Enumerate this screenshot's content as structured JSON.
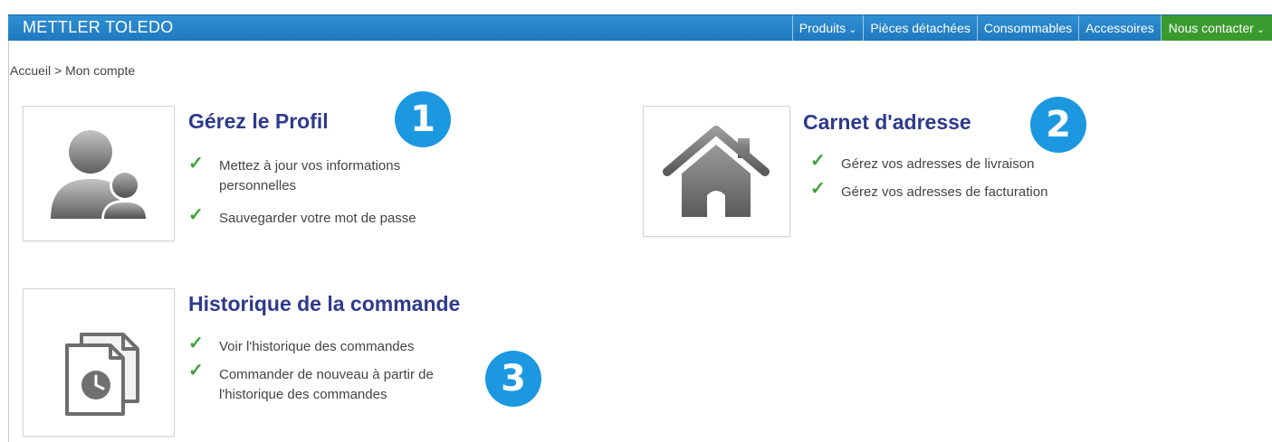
{
  "header": {
    "brand": "METTLER TOLEDO",
    "nav": [
      {
        "label": "Produits",
        "dropdown": true
      },
      {
        "label": "Pièces détachées"
      },
      {
        "label": "Consommables"
      },
      {
        "label": "Accessoires"
      },
      {
        "label": "Nous contacter",
        "dropdown": true
      }
    ]
  },
  "breadcrumb": {
    "home": "Accueil",
    "separator": ">",
    "current": "Mon compte"
  },
  "sections": {
    "profile": {
      "title": "Gérez le Profil",
      "badge": "1",
      "items": [
        "Mettez à jour vos informations personnelles",
        "Sauvegarder votre mot de passe"
      ],
      "icon": "user-profile-icon"
    },
    "addresses": {
      "title": "Carnet d'adresse",
      "badge": "2",
      "items": [
        "Gérez vos adresses de livraison",
        "Gérez vos adresses de facturation"
      ],
      "icon": "house-icon"
    },
    "orders": {
      "title": "Historique de la commande",
      "badge": "3",
      "items": [
        "Voir l'historique des commandes",
        "Commander de nouveau à partir de l'historique des commandes"
      ],
      "icon": "order-history-icon"
    }
  },
  "colors": {
    "topbar": "#1f78be",
    "contact": "#3b9a2e",
    "title": "#2e3a8c",
    "check": "#3ea23c",
    "badge": "#1b98e0"
  }
}
